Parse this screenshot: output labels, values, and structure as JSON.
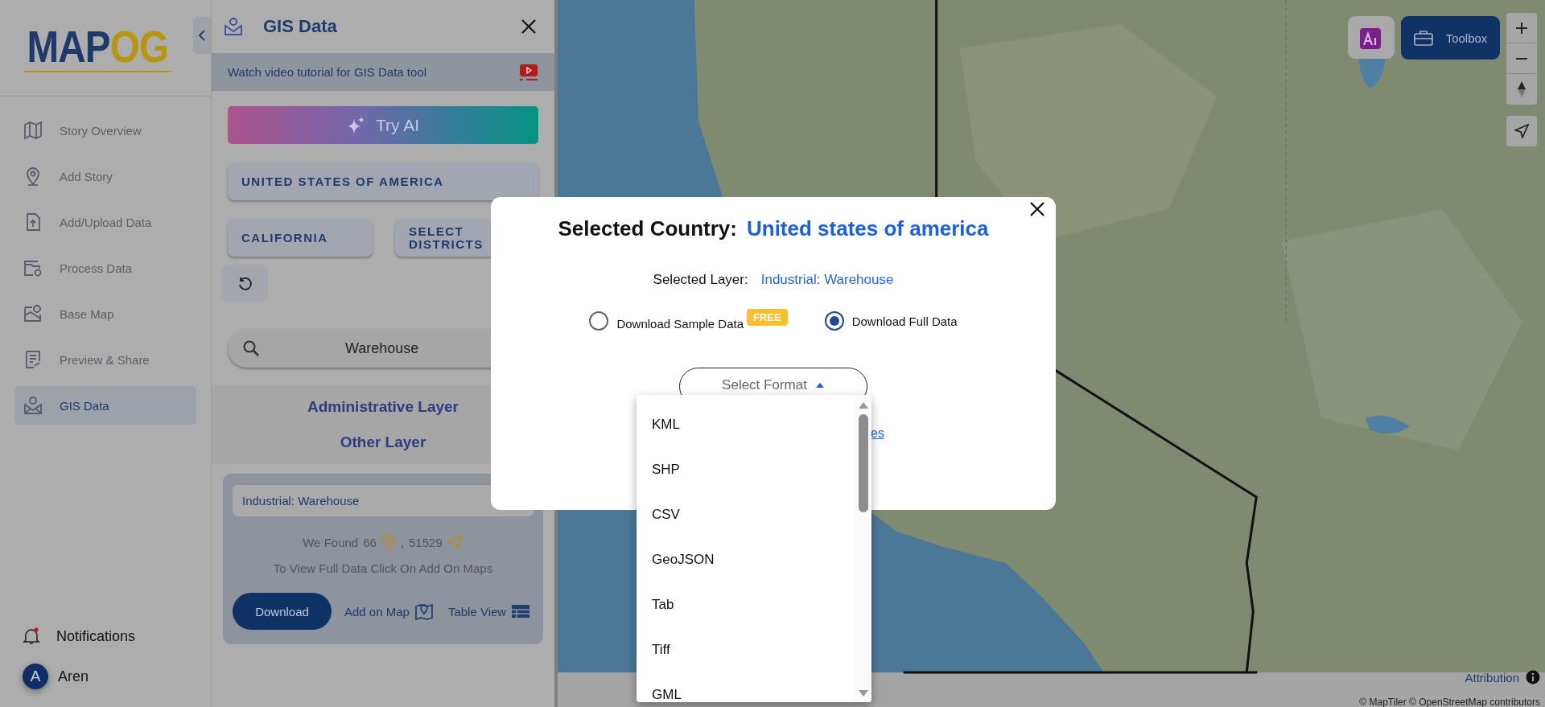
{
  "nav": {
    "logo": {
      "left": "MAP",
      "right": "OG"
    },
    "items": [
      {
        "label": "Story Overview",
        "selected": false
      },
      {
        "label": "Add Story",
        "selected": false
      },
      {
        "label": "Add/Upload Data",
        "selected": false
      },
      {
        "label": "Process Data",
        "selected": false
      },
      {
        "label": "Base Map",
        "selected": false
      },
      {
        "label": "Preview & Share",
        "selected": false
      },
      {
        "label": "GIS Data",
        "selected": true
      }
    ],
    "notifications": {
      "label": "Notifications",
      "unread": true
    },
    "user": {
      "initial": "A",
      "name": "Aren"
    }
  },
  "panel": {
    "title": "GIS Data",
    "tutorial": "Watch video tutorial for GIS Data tool",
    "try_ai": "Try AI",
    "country": "UNITED STATES OF AMERICA",
    "state": "CALIFORNIA",
    "districts": "SELECT DISTRICTS",
    "search": {
      "value": "Warehouse"
    },
    "layer_sections": [
      "Administrative Layer",
      "Other Layer"
    ],
    "card": {
      "layer": "Industrial: Warehouse",
      "found_label": "We Found",
      "points": "66",
      "separator": ",",
      "lines": "51529",
      "hint": "To View Full Data Click On Add On Maps",
      "download": "Download",
      "add_on_map": "Add on Map",
      "table_view": "Table View"
    }
  },
  "map": {
    "toolbox": "Toolbox",
    "attribution": "Attribution",
    "copyright": "© MapTiler © OpenStreetMap contributors"
  },
  "modal": {
    "country_label": "Selected Country:",
    "country": "United states of america",
    "layer_label": "Selected Layer:",
    "layer": "Industrial: Warehouse",
    "options": [
      {
        "label": "Download Sample Data",
        "selected": false,
        "badge": "FREE"
      },
      {
        "label": "Download Full Data",
        "selected": true
      }
    ],
    "format": {
      "placeholder": "Select Format",
      "expanded": true,
      "options": [
        "KML",
        "SHP",
        "CSV",
        "GeoJSON",
        "Tab",
        "Tiff",
        "GML"
      ]
    },
    "link_fragment": "es"
  }
}
